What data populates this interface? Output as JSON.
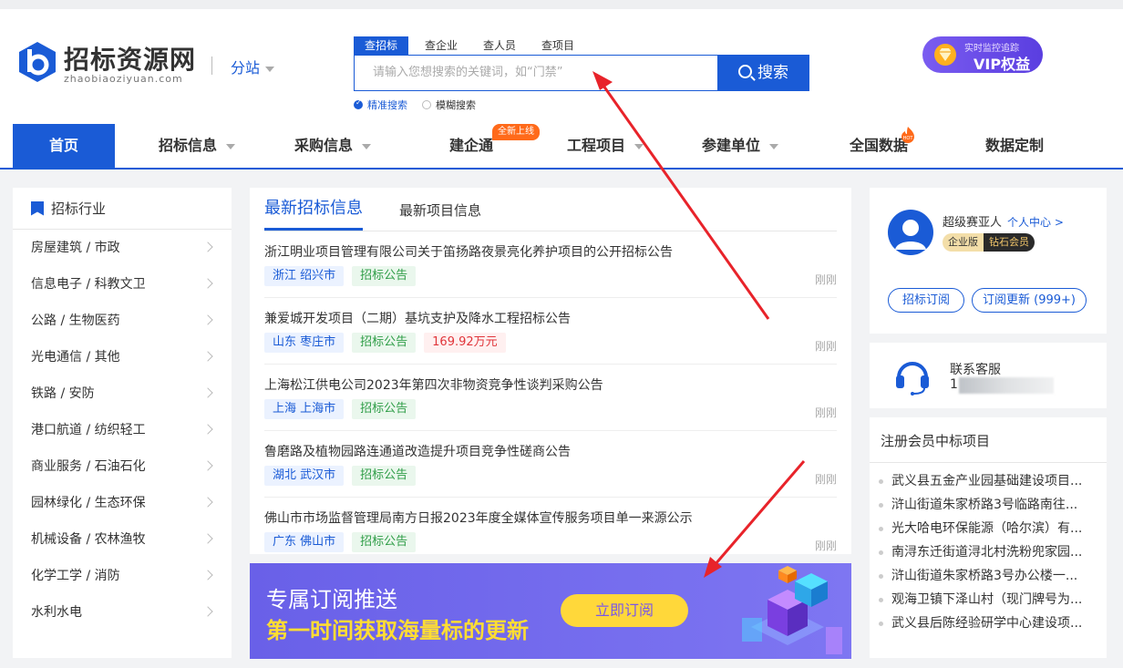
{
  "header": {
    "brand": "招标资源网",
    "brand_sub": "zhaobiaoziyuan.com",
    "branch": "分站",
    "search_tabs": [
      "查招标",
      "查企业",
      "查人员",
      "查项目"
    ],
    "search_placeholder": "请输入您想搜索的关键词，如“门禁”",
    "search_button": "搜索",
    "search_modes": [
      "精准搜索",
      "模糊搜索"
    ],
    "vip_small": "实时监控追踪",
    "vip_big": "VIP权益"
  },
  "nav": {
    "items": [
      "首页",
      "招标信息",
      "采购信息",
      "建企通",
      "工程项目",
      "参建单位",
      "全国数据",
      "数据定制"
    ],
    "new_badge": "全新上线",
    "hot_badge": "HOT"
  },
  "industry": {
    "title": "招标行业",
    "items": [
      "房屋建筑 / 市政",
      "信息电子 / 科教文卫",
      "公路 / 生物医药",
      "光电通信 / 其他",
      "铁路 / 安防",
      "港口航道 / 纺织轻工",
      "商业服务 / 石油石化",
      "园林绿化 / 生态环保",
      "机械设备 / 农林渔牧",
      "化学工学 / 消防",
      "水利水电"
    ]
  },
  "feed": {
    "tabs": [
      "最新招标信息",
      "最新项目信息"
    ],
    "items": [
      {
        "title": "浙江明业项目管理有限公司关于笛扬路夜景亮化养护项目的公开招标公告",
        "location": "浙江 绍兴市",
        "type": "招标公告",
        "amount": "",
        "time": "刚刚"
      },
      {
        "title": "兼爱城开发项目（二期）基坑支护及降水工程招标公告",
        "location": "山东 枣庄市",
        "type": "招标公告",
        "amount": "169.92万元",
        "time": "刚刚"
      },
      {
        "title": "上海松江供电公司2023年第四次非物资竞争性谈判采购公告",
        "location": "上海 上海市",
        "type": "招标公告",
        "amount": "",
        "time": "刚刚"
      },
      {
        "title": "鲁磨路及植物园路连通道改造提升项目竞争性磋商公告",
        "location": "湖北 武汉市",
        "type": "招标公告",
        "amount": "",
        "time": "刚刚"
      },
      {
        "title": "佛山市市场监督管理局南方日报2023年度全媒体宣传服务项目单一来源公示",
        "location": "广东 佛山市",
        "type": "招标公告",
        "amount": "",
        "time": "刚刚"
      }
    ]
  },
  "banner": {
    "line1": "专属订阅推送",
    "line2": "第一时间获取海量标的更新",
    "button": "立即订阅"
  },
  "user": {
    "name": "超级赛亚人",
    "center_link": "个人中心 >",
    "level_a": "企业版",
    "level_b": "钻石会员",
    "btn_subscribe": "招标订阅",
    "btn_updates": "订阅更新 (999+)"
  },
  "service": {
    "label": "联系客服",
    "phone_visible": "1"
  },
  "winners": {
    "title": "注册会员中标项目",
    "items": [
      "武义县五金产业园基础建设项目...",
      "浒山街道朱家桥路3号临路南往...",
      "光大哈电环保能源（哈尔滨）有...",
      "南浔东迁街道浔北村洗粉兜家园...",
      "浒山街道朱家桥路3号办公楼一...",
      "观海卫镇下泽山村（现门牌号为...",
      "武义县后陈经验研学中心建设项..."
    ]
  },
  "colors": {
    "brand_blue": "#1a5bd6",
    "annotation_red": "#e8232a"
  }
}
